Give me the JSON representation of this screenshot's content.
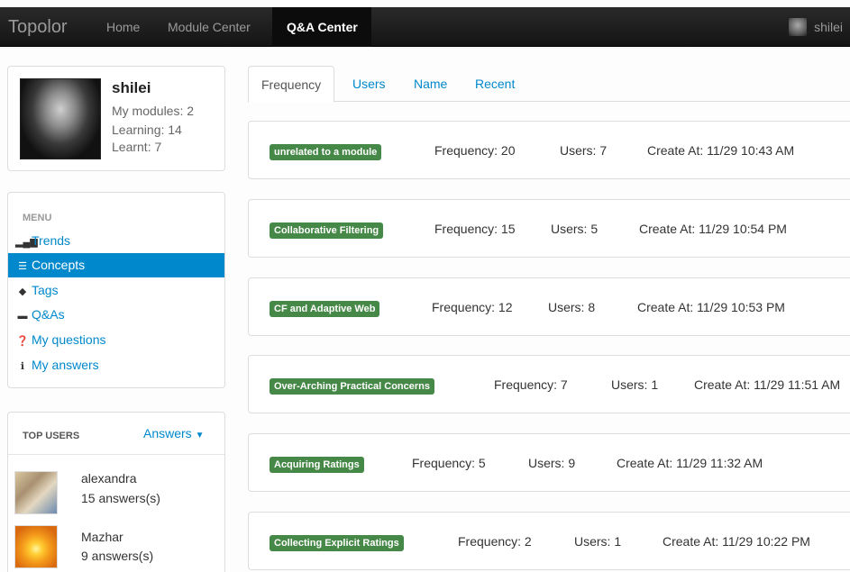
{
  "navbar": {
    "brand": "Topolor",
    "links": [
      "Home",
      "Module Center",
      "Q&A Center"
    ],
    "user": "shilei"
  },
  "profile": {
    "name": "shilei",
    "modules": "My modules: 2",
    "learning": "Learning: 14",
    "learnt": "Learnt: 7"
  },
  "menu": {
    "header": "MENU",
    "items": [
      {
        "label": "Trends",
        "icon": "signal-icon"
      },
      {
        "label": "Concepts",
        "icon": "list-icon"
      },
      {
        "label": "Tags",
        "icon": "tag-icon"
      },
      {
        "label": "Q&As",
        "icon": "comment-icon"
      },
      {
        "label": "My questions",
        "icon": "question-icon"
      },
      {
        "label": "My answers",
        "icon": "info-icon"
      }
    ]
  },
  "top_users": {
    "header": "TOP USERS",
    "dropdown": "Answers",
    "users": [
      {
        "name": "alexandra",
        "count": "15 answers(s)"
      },
      {
        "name": "Mazhar",
        "count": "9 answers(s)"
      }
    ]
  },
  "tabs": [
    "Frequency",
    "Users",
    "Name",
    "Recent"
  ],
  "concepts": [
    {
      "tag": "unrelated to a module",
      "frequency": "Frequency: 20",
      "users": "Users: 7",
      "created": "Create At: 11/29 10:43 AM"
    },
    {
      "tag": "Collaborative Filtering",
      "frequency": "Frequency: 15",
      "users": "Users: 5",
      "created": "Create At: 11/29 10:54 PM"
    },
    {
      "tag": "CF and Adaptive Web",
      "frequency": "Frequency: 12",
      "users": "Users: 8",
      "created": "Create At: 11/29 10:53 PM"
    },
    {
      "tag": "Over-Arching Practical Concerns",
      "frequency": "Frequency: 7",
      "users": "Users: 1",
      "created": "Create At: 11/29 11:51 AM"
    },
    {
      "tag": "Acquiring Ratings",
      "frequency": "Frequency: 5",
      "users": "Users: 9",
      "created": "Create At: 11/29 11:32 AM"
    },
    {
      "tag": "Collecting Explicit Ratings",
      "frequency": "Frequency: 2",
      "users": "Users: 1",
      "created": "Create At: 11/29 10:22 PM"
    }
  ],
  "colors": {
    "accent": "#0088cc",
    "badge": "#468847",
    "navbar": "#1b1b1b"
  }
}
